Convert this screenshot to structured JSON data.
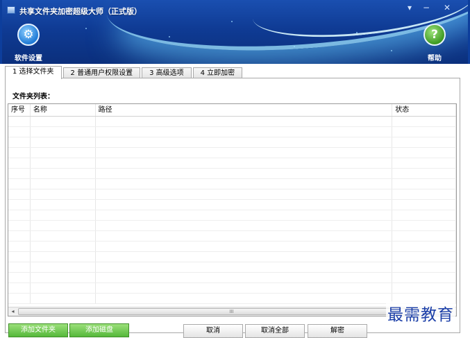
{
  "window": {
    "title": "共享文件夹加密超级大师（正式版）",
    "controls": {
      "menu": "▾",
      "minimize": "−",
      "close": "✕"
    }
  },
  "toolbar": {
    "settings_label": "软件设置",
    "settings_icon": "gear-icon",
    "help_label": "帮助",
    "help_icon": "help-icon",
    "help_glyph": "?",
    "settings_glyph": "⚙"
  },
  "tabs": [
    {
      "label": "1 选择文件夹",
      "active": true
    },
    {
      "label": "2 普通用户权限设置",
      "active": false
    },
    {
      "label": "3 高级选项",
      "active": false
    },
    {
      "label": "4 立即加密",
      "active": false
    }
  ],
  "panel": {
    "list_label": "文件夹列表：",
    "columns": [
      "序号",
      "名称",
      "路径",
      "状态"
    ],
    "rows": []
  },
  "scrollbar": {
    "left": "◂",
    "right": "▸",
    "grip": "III"
  },
  "buttons": {
    "add_folder": "添加文件夹",
    "add_drive": "添加磁盘",
    "cancel": "取消",
    "cancel_all": "取消全部",
    "decrypt": "解密"
  },
  "watermark": "最需教育",
  "colors": {
    "header": "#0f3b94",
    "accent_green": "#55b83a"
  }
}
